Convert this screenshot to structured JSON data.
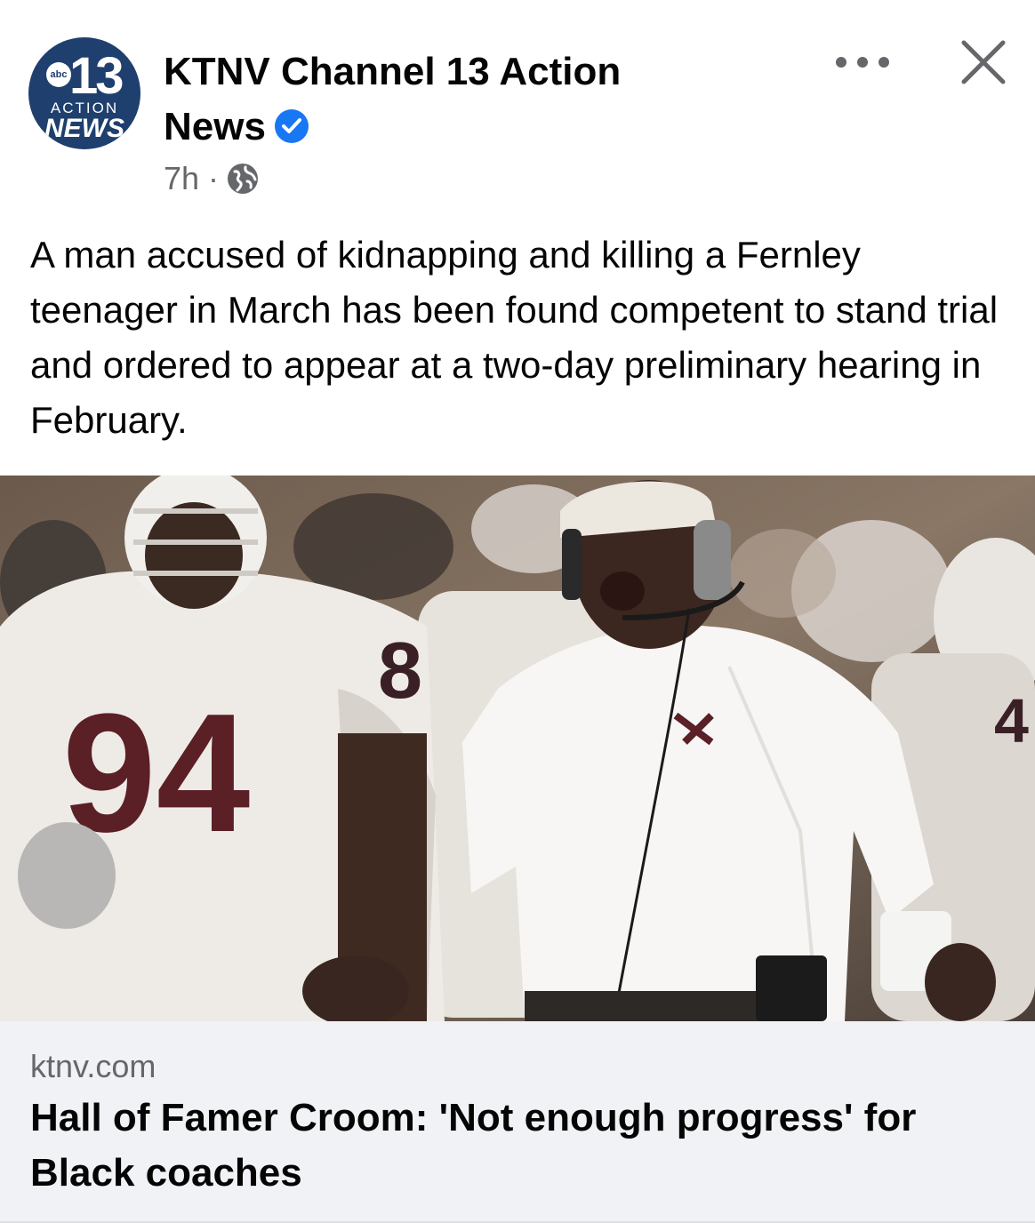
{
  "post": {
    "page_name": "KTNV Channel 13 Action News",
    "avatar": {
      "channel_number": "13",
      "network": "abc",
      "line1": "ACTION",
      "line2": "NEWS"
    },
    "timestamp": "7h",
    "separator": "·",
    "audience_icon": "globe-icon",
    "verified_icon": "verified-badge-icon",
    "caption": "A man accused of kidnapping and killing a Fernley teenager in March has been found competent to stand trial and ordered to appear at a two-day preliminary hearing in February."
  },
  "actions": {
    "more_icon": "more-options-icon",
    "close_icon": "close-icon"
  },
  "link_preview": {
    "domain": "ktnv.com",
    "headline": "Hall of Famer Croom: 'Not enough progress' for Black coaches"
  },
  "photo_text": {
    "jersey_left": "94",
    "jersey_partial": "8",
    "jersey_right": "4"
  },
  "colors": {
    "brand_navy": "#1f3f6e",
    "verified_blue": "#1877f2",
    "secondary_text": "#65676b",
    "card_bg": "#f0f2f5",
    "jersey_maroon": "#5b1f26"
  }
}
